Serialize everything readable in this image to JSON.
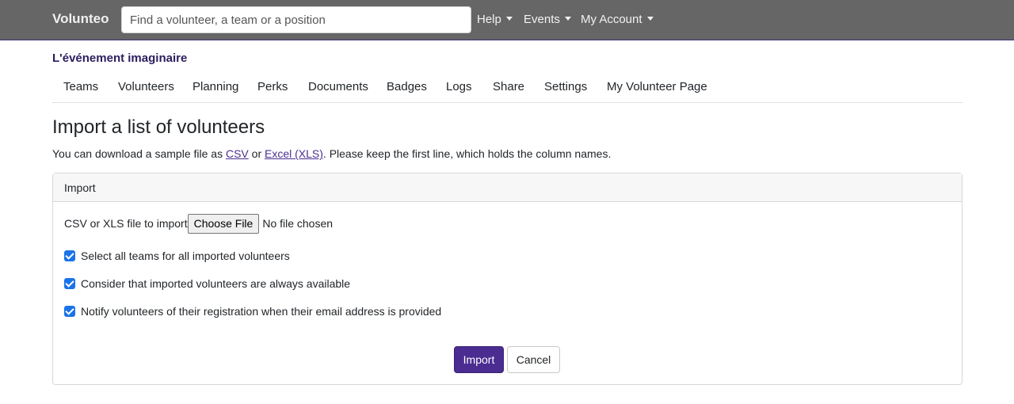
{
  "navbar": {
    "brand": "Volunteo",
    "search_placeholder": "Find a volunteer, a team or a position",
    "menus": [
      "Help",
      "Events",
      "My Account"
    ]
  },
  "event": {
    "name": "L'événement imaginaire"
  },
  "tabs": [
    "Teams",
    "Volunteers",
    "Planning",
    "Perks",
    "Documents",
    "Badges",
    "Logs",
    "Share",
    "Settings",
    "My Volunteer Page"
  ],
  "page": {
    "title": "Import a list of volunteers",
    "intro_before": "You can download a sample file as ",
    "csv_link": "CSV",
    "intro_or": " or ",
    "xls_link": "Excel (XLS)",
    "intro_after": ". Please keep the first line, which holds the column names."
  },
  "form": {
    "card_title": "Import",
    "file_label": "CSV or XLS file to import",
    "choose_file_label": "Choose File",
    "no_file_text": "No file chosen",
    "options": [
      {
        "label": "Select all teams for all imported volunteers",
        "checked": true
      },
      {
        "label": "Consider that imported volunteers are always available",
        "checked": true
      },
      {
        "label": "Notify volunteers of their registration when their email address is provided",
        "checked": true
      }
    ],
    "submit_label": "Import",
    "cancel_label": "Cancel"
  },
  "colors": {
    "navbar_bg": "#666666",
    "primary": "#4b2c91",
    "link": "#4a2f8f",
    "checkbox": "#1a73e8"
  }
}
